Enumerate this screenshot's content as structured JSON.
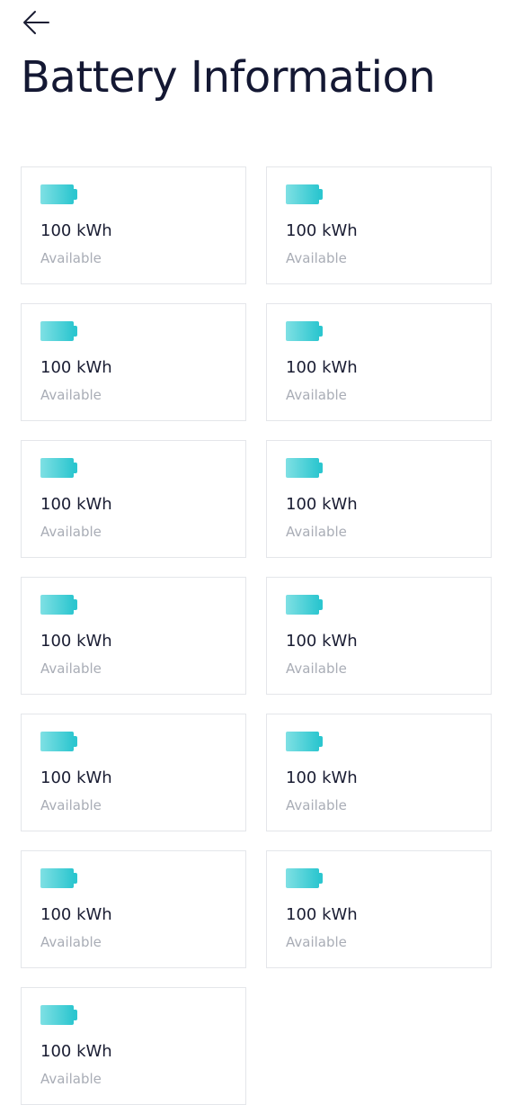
{
  "header": {
    "back_icon": "arrow-left-icon",
    "title": "Battery Information"
  },
  "battery_icon": "battery-icon",
  "colors": {
    "title": "#141833",
    "battery_fill_start": "#7fe0e4",
    "battery_fill_end": "#2cc6cf",
    "card_border": "#e4e6ea",
    "status_text": "#a9adb6"
  },
  "batteries": [
    {
      "capacity": "100 kWh",
      "status": "Available"
    },
    {
      "capacity": "100 kWh",
      "status": "Available"
    },
    {
      "capacity": "100 kWh",
      "status": "Available"
    },
    {
      "capacity": "100 kWh",
      "status": "Available"
    },
    {
      "capacity": "100 kWh",
      "status": "Available"
    },
    {
      "capacity": "100 kWh",
      "status": "Available"
    },
    {
      "capacity": "100 kWh",
      "status": "Available"
    },
    {
      "capacity": "100 kWh",
      "status": "Available"
    },
    {
      "capacity": "100 kWh",
      "status": "Available"
    },
    {
      "capacity": "100 kWh",
      "status": "Available"
    },
    {
      "capacity": "100 kWh",
      "status": "Available"
    },
    {
      "capacity": "100 kWh",
      "status": "Available"
    },
    {
      "capacity": "100 kWh",
      "status": "Available"
    }
  ]
}
